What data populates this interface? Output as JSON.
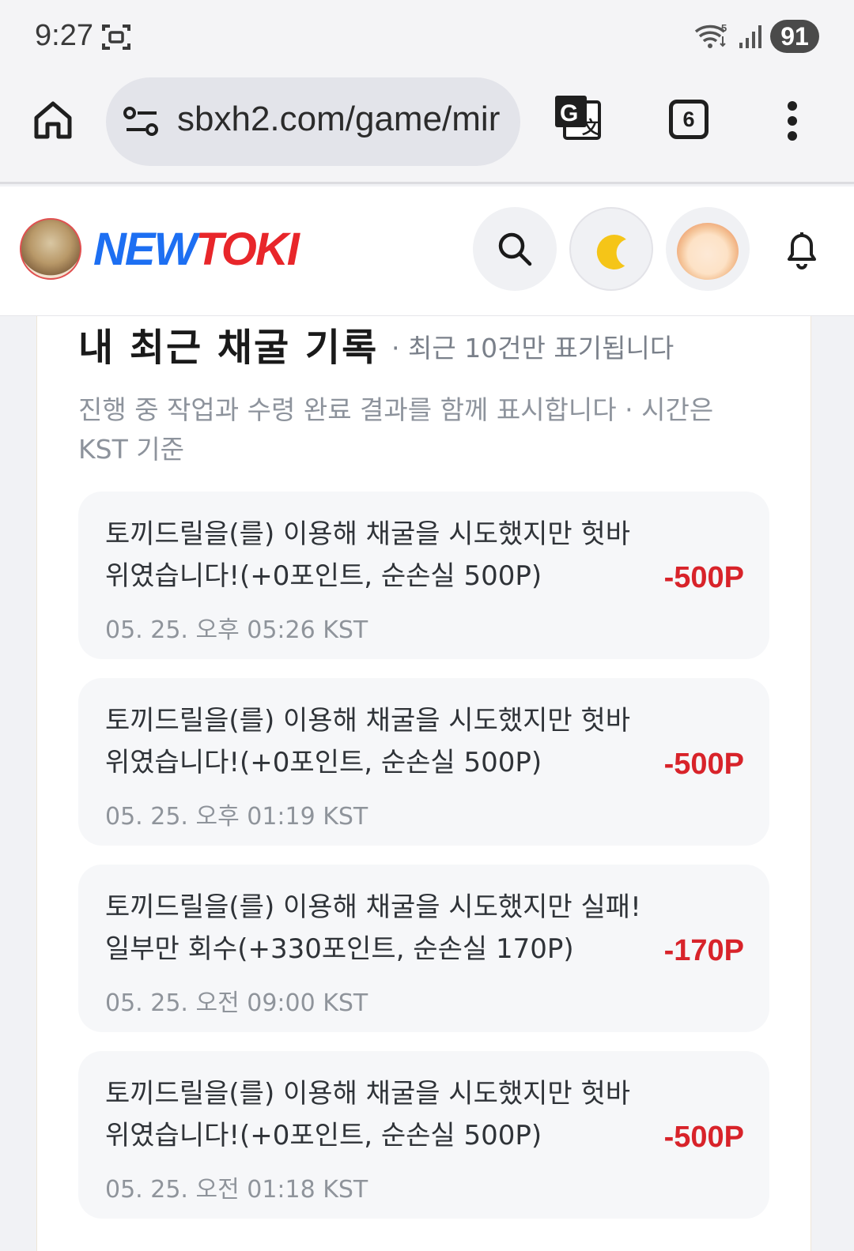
{
  "status_bar": {
    "time": "9:27",
    "battery": "91"
  },
  "browser": {
    "url": "sbxh2.com/game/mir",
    "tab_count": "6"
  },
  "header": {
    "logo_part1": "NEW",
    "logo_part2": "TOKI"
  },
  "section": {
    "title": "내 최근 채굴 기록",
    "note": "· 최근 10건만 표기됩니다",
    "description": "진행 중 작업과 수령 완료 결과를 함께 표시합니다 · 시간은 KST 기준"
  },
  "records": [
    {
      "message": "토끼드릴을(를) 이용해 채굴을 시도했지만 헛바위였습니다!(+0포인트, 순손실 500P)",
      "time": "05. 25. 오후 05:26 KST",
      "amount": "-500P"
    },
    {
      "message": "토끼드릴을(를) 이용해 채굴을 시도했지만 헛바위였습니다!(+0포인트, 순손실 500P)",
      "time": "05. 25. 오후 01:19 KST",
      "amount": "-500P"
    },
    {
      "message": "토끼드릴을(를) 이용해 채굴을 시도했지만 실패! 일부만 회수(+330포인트, 순손실 170P)",
      "time": "05. 25. 오전 09:00 KST",
      "amount": "-170P"
    },
    {
      "message": "토끼드릴을(를) 이용해 채굴을 시도했지만 헛바위였습니다!(+0포인트, 순손실 500P)",
      "time": "05. 25. 오전 01:18 KST",
      "amount": "-500P"
    }
  ],
  "colors": {
    "accent_negative": "#d8232a",
    "logo_blue": "#1d6ff2",
    "logo_red": "#e8262a"
  }
}
